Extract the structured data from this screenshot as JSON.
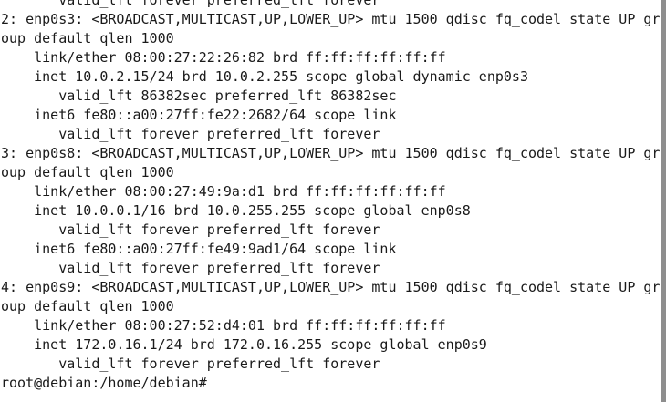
{
  "terminal": {
    "lines": [
      "       valid_lft forever preferred_lft forever",
      "2: enp0s3: <BROADCAST,MULTICAST,UP,LOWER_UP> mtu 1500 qdisc fq_codel state UP gr",
      "oup default qlen 1000",
      "    link/ether 08:00:27:22:26:82 brd ff:ff:ff:ff:ff:ff",
      "    inet 10.0.2.15/24 brd 10.0.2.255 scope global dynamic enp0s3",
      "       valid_lft 86382sec preferred_lft 86382sec",
      "    inet6 fe80::a00:27ff:fe22:2682/64 scope link",
      "       valid_lft forever preferred_lft forever",
      "3: enp0s8: <BROADCAST,MULTICAST,UP,LOWER_UP> mtu 1500 qdisc fq_codel state UP gr",
      "oup default qlen 1000",
      "    link/ether 08:00:27:49:9a:d1 brd ff:ff:ff:ff:ff:ff",
      "    inet 10.0.0.1/16 brd 10.0.255.255 scope global enp0s8",
      "       valid_lft forever preferred_lft forever",
      "    inet6 fe80::a00:27ff:fe49:9ad1/64 scope link",
      "       valid_lft forever preferred_lft forever",
      "4: enp0s9: <BROADCAST,MULTICAST,UP,LOWER_UP> mtu 1500 qdisc fq_codel state UP gr",
      "oup default qlen 1000",
      "    link/ether 08:00:27:52:d4:01 brd ff:ff:ff:ff:ff:ff",
      "    inet 172.0.16.1/24 brd 172.0.16.255 scope global enp0s9",
      "       valid_lft forever preferred_lft forever",
      "root@debian:/home/debian# "
    ]
  },
  "colors": {
    "background": "#ffffff",
    "text": "#1a1a1a",
    "scrollbar": "#8e8e8e"
  }
}
